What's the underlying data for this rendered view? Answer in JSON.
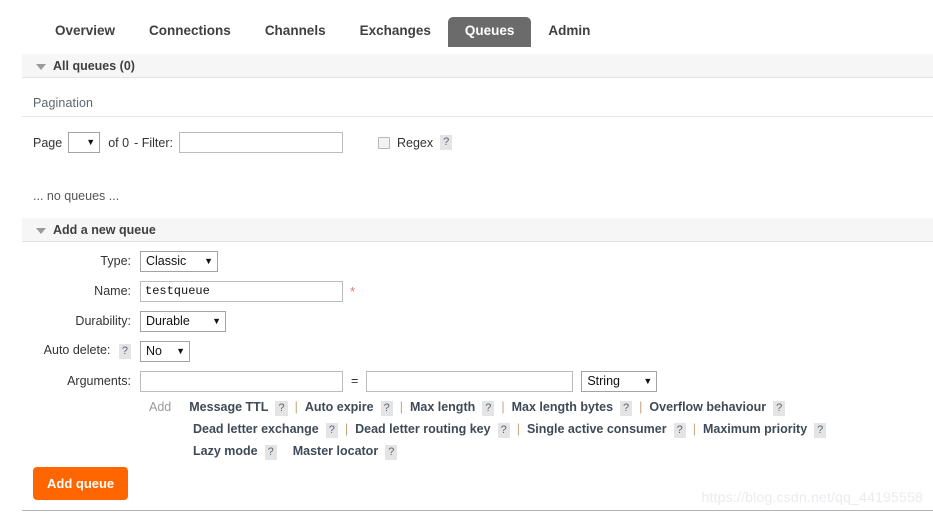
{
  "nav": {
    "tabs": [
      {
        "label": "Overview",
        "active": false
      },
      {
        "label": "Connections",
        "active": false
      },
      {
        "label": "Channels",
        "active": false
      },
      {
        "label": "Exchanges",
        "active": false
      },
      {
        "label": "Queues",
        "active": true
      },
      {
        "label": "Admin",
        "active": false
      }
    ]
  },
  "all_queues": {
    "header": "All queues (0)",
    "pagination_label": "Pagination",
    "page_label": "Page",
    "page_value": "",
    "of_text": "of 0",
    "filter_label": "- Filter:",
    "filter_value": "",
    "regex_label": "Regex",
    "regex_help": "?",
    "regex_checked": false,
    "empty_text": "... no queues ..."
  },
  "add_queue": {
    "header": "Add a new queue",
    "fields": {
      "type_label": "Type:",
      "type_value": "Classic",
      "name_label": "Name:",
      "name_value": "testqueue",
      "name_required_mark": "*",
      "durability_label": "Durability:",
      "durability_value": "Durable",
      "auto_delete_label": "Auto delete:",
      "auto_delete_help": "?",
      "auto_delete_value": "No",
      "arguments_label": "Arguments:",
      "argument_key": "",
      "argument_value": "",
      "argument_equals": "=",
      "argument_type_value": "String"
    },
    "add_word": "Add",
    "presets_row1": [
      {
        "label": "Message TTL",
        "help": "?"
      },
      {
        "label": "Auto expire",
        "help": "?"
      },
      {
        "label": "Max length",
        "help": "?"
      },
      {
        "label": "Max length bytes",
        "help": "?"
      },
      {
        "label": "Overflow behaviour",
        "help": "?"
      }
    ],
    "presets_row2": [
      {
        "label": "Dead letter exchange",
        "help": "?"
      },
      {
        "label": "Dead letter routing key",
        "help": "?"
      },
      {
        "label": "Single active consumer",
        "help": "?"
      },
      {
        "label": "Maximum priority",
        "help": "?"
      }
    ],
    "presets_row3": [
      {
        "label": "Lazy mode",
        "help": "?"
      },
      {
        "label": "Master locator",
        "help": "?"
      }
    ],
    "separator": "|",
    "submit_label": "Add queue"
  },
  "watermark": "https://blog.csdn.net/qq_44195558",
  "colors": {
    "accent": "#ff6600",
    "active_tab_bg": "#6b6b6b",
    "required_mark": "#e8736a"
  }
}
